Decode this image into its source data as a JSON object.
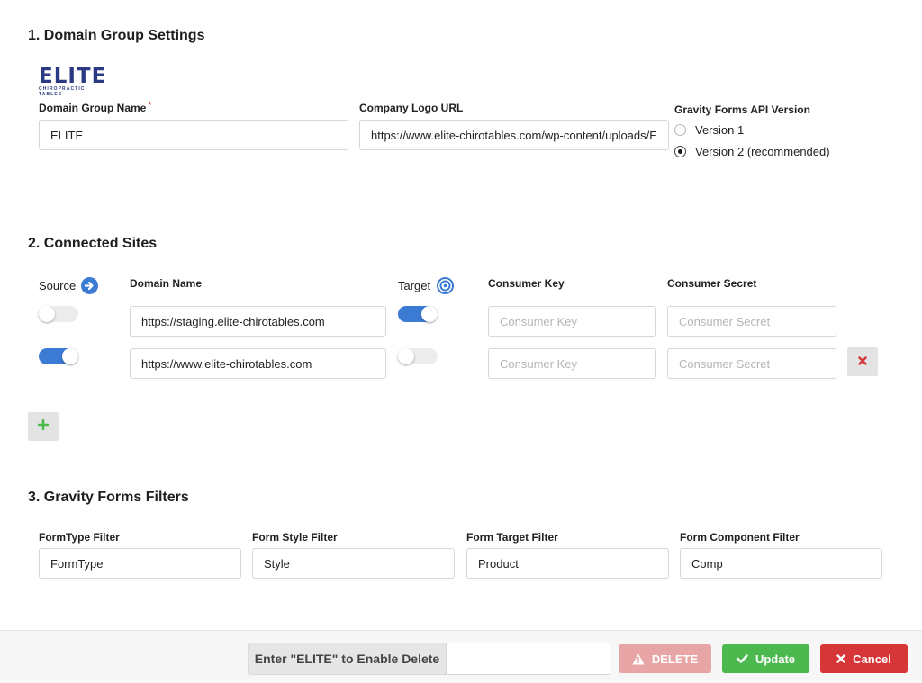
{
  "section1": {
    "title": "1. Domain Group Settings",
    "logo": {
      "main": "ELITE",
      "sub": "CHIROPRACTIC TABLES"
    },
    "domain_group_name": {
      "label": "Domain Group Name",
      "required_mark": "*",
      "value": "ELITE"
    },
    "company_logo_url": {
      "label": "Company Logo URL",
      "value": "https://www.elite-chirotables.com/wp-content/uploads/E"
    },
    "api_version": {
      "label": "Gravity Forms API Version",
      "options": [
        {
          "label": "Version 1",
          "checked": false
        },
        {
          "label": "Version 2 (recommended)",
          "checked": true
        }
      ]
    }
  },
  "section2": {
    "title": "2. Connected Sites",
    "headers": {
      "source": "Source",
      "domain_name": "Domain Name",
      "target": "Target",
      "consumer_key": "Consumer Key",
      "consumer_secret": "Consumer Secret"
    },
    "rows": [
      {
        "source_on": false,
        "domain": "https://staging.elite-chirotables.com",
        "target_on": true,
        "key_placeholder": "Consumer Key",
        "secret_placeholder": "Consumer Secret"
      },
      {
        "source_on": true,
        "domain": "https://www.elite-chirotables.com",
        "target_on": false,
        "key_placeholder": "Consumer Key",
        "secret_placeholder": "Consumer Secret"
      }
    ],
    "icons": {
      "source": "arrow-right-circle-icon",
      "target": "target-icon",
      "remove": "close-icon",
      "add": "plus-icon"
    }
  },
  "section3": {
    "title": "3. Gravity Forms Filters",
    "filters": [
      {
        "label": "FormType Filter",
        "value": "FormType"
      },
      {
        "label": "Form Style Filter",
        "value": "Style"
      },
      {
        "label": "Form Target Filter",
        "value": "Product"
      },
      {
        "label": "Form Component Filter",
        "value": "Comp"
      }
    ]
  },
  "footer": {
    "delete_prompt": "Enter \"ELITE\" to Enable Delete",
    "delete_input_value": "",
    "delete_label": "DELETE",
    "update_label": "Update",
    "cancel_label": "Cancel"
  },
  "colors": {
    "accent_blue": "#3b7bd4",
    "delete_disabled": "#e8a5a5",
    "update_green": "#4cb94f",
    "cancel_red": "#d63638",
    "logo_navy": "#2b3a82"
  }
}
